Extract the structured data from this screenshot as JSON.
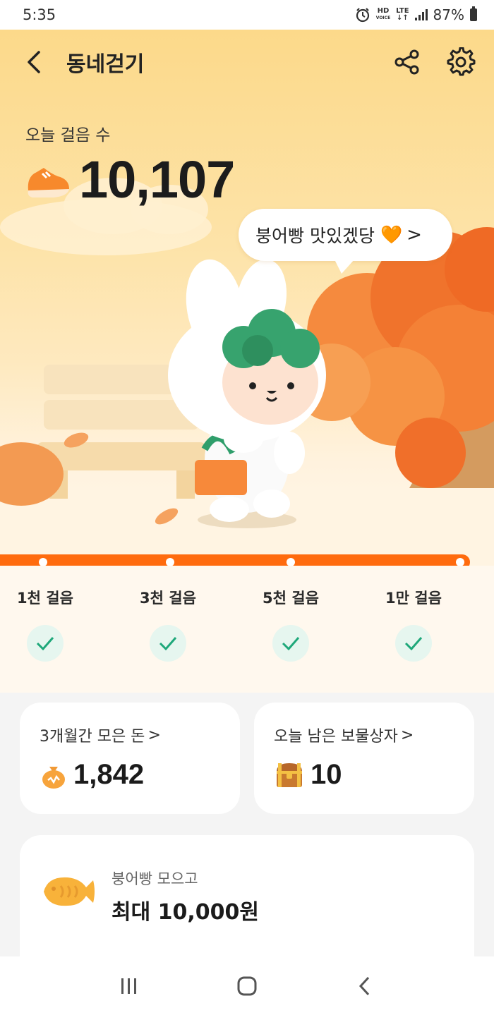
{
  "status_bar": {
    "time": "5:35",
    "hd_top": "HD",
    "hd_bottom": "VOICE",
    "lte_top": "LTE",
    "lte_bottom": "↓↑",
    "battery": "87%"
  },
  "header": {
    "title": "동네걷기",
    "back_icon": "back-arrow-icon",
    "share_icon": "share-icon",
    "settings_icon": "gear-icon"
  },
  "steps": {
    "label": "오늘 걸음 수",
    "value": "10,107",
    "icon": "sneaker-icon"
  },
  "speech_bubble": {
    "text": "붕어빵 맛있겠당",
    "heart": "🧡",
    "chevron": ">"
  },
  "milestones": [
    {
      "label": "1천 걸음",
      "completed": true
    },
    {
      "label": "3천 걸음",
      "completed": true
    },
    {
      "label": "5천 걸음",
      "completed": true
    },
    {
      "label": "1만 걸음",
      "completed": true
    }
  ],
  "progress_fraction": 1.0,
  "cards": {
    "money": {
      "title": "3개월간 모은 돈",
      "chevron": ">",
      "value": "1,842",
      "icon": "money-bag-icon"
    },
    "treasure": {
      "title": "오늘 남은 보물상자",
      "chevron": ">",
      "value": "10",
      "icon": "treasure-chest-icon"
    }
  },
  "promo": {
    "subtitle": "붕어빵 모으고",
    "title": "최대 10,000원",
    "icon": "fish-bread-icon"
  },
  "nav": {
    "recents_icon": "recents-icon",
    "home_icon": "home-icon",
    "back_icon": "nav-back-icon"
  },
  "colors": {
    "accent": "#ff6b0e",
    "check_green": "#1ea87a",
    "check_bg": "#e6f6ef"
  }
}
